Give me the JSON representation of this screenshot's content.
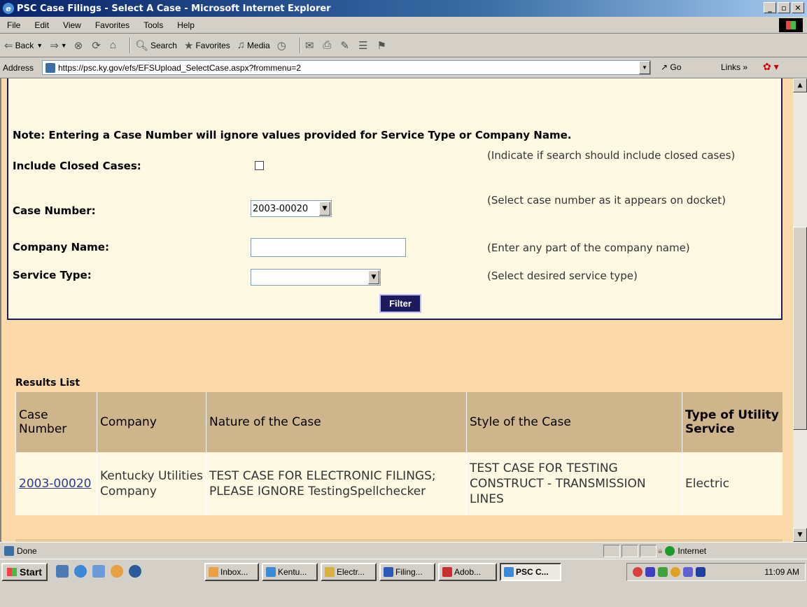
{
  "window": {
    "title": "PSC Case Filings - Select A Case - Microsoft Internet Explorer"
  },
  "menu": [
    "File",
    "Edit",
    "View",
    "Favorites",
    "Tools",
    "Help"
  ],
  "toolbar": {
    "back": "Back",
    "search": "Search",
    "favorites": "Favorites",
    "media": "Media"
  },
  "address": {
    "label": "Address",
    "url": "https://psc.ky.gov/efs/EFSUpload_SelectCase.aspx?frommenu=2",
    "go": "Go",
    "links": "Links"
  },
  "form": {
    "note": "Note: Entering a Case Number will ignore values provided for Service Type or Company Name.",
    "closed_label": "Include Closed Cases:",
    "closed_help": "(Indicate if search should include closed cases)",
    "case_label": "Case Number:",
    "case_value": "2003-00020",
    "case_help": "(Select case number as it appears on docket)",
    "company_label": "Company Name:",
    "company_value": "",
    "company_help": "(Enter any part of the company name)",
    "service_label": "Service Type:",
    "service_value": "",
    "service_help": "(Select desired service type)",
    "filter_label": "Filter"
  },
  "results": {
    "title": "Results List",
    "headers": [
      "Case Number",
      "Company",
      "Nature of the Case",
      "Style of the Case",
      "Type of Utility Service"
    ],
    "rows": [
      {
        "case_number": "2003-00020",
        "company": "Kentucky Utilities Company",
        "nature": "TEST CASE FOR ELECTRONIC FILINGS; PLEASE IGNORE TestingSpellchecker",
        "style": "TEST CASE FOR TESTING CONSTRUCT - TRANSMISSION LINES",
        "service": "Electric"
      }
    ]
  },
  "status": {
    "text": "Done",
    "zone": "Internet"
  },
  "taskbar": {
    "start": "Start",
    "tasks": [
      "Inbox...",
      "Kentu...",
      "Electr...",
      "Filing...",
      "Adob...",
      "PSC C..."
    ],
    "clock": "11:09 AM"
  }
}
